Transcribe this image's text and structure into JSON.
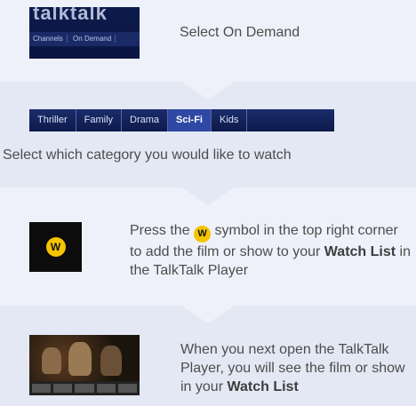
{
  "steps": [
    {
      "text": "Select On Demand",
      "thumb_logo": "talktalk",
      "thumb_menu": [
        "Channels",
        "On Demand"
      ]
    },
    {
      "categories": [
        "Thriller",
        "Family",
        "Drama",
        "Sci-Fi",
        "Kids"
      ],
      "active_category": "Sci-Fi",
      "text": "Select which category you would like to watch"
    },
    {
      "icon_letter": "W",
      "text_before": "Press the",
      "text_after": "symbol in the top right corner to add the film or show to your",
      "bold": "Watch List",
      "text_end": "in the TalkTalk Player"
    },
    {
      "text": "When you next open the TalkTalk Player, you will see the film or show in your",
      "bold": "Watch List"
    }
  ],
  "colors": {
    "band_light": "#eef1f9",
    "band_dark": "#e3e8f4",
    "w_yellow": "#f5c400",
    "menu_blue": "#1b2c6b"
  }
}
